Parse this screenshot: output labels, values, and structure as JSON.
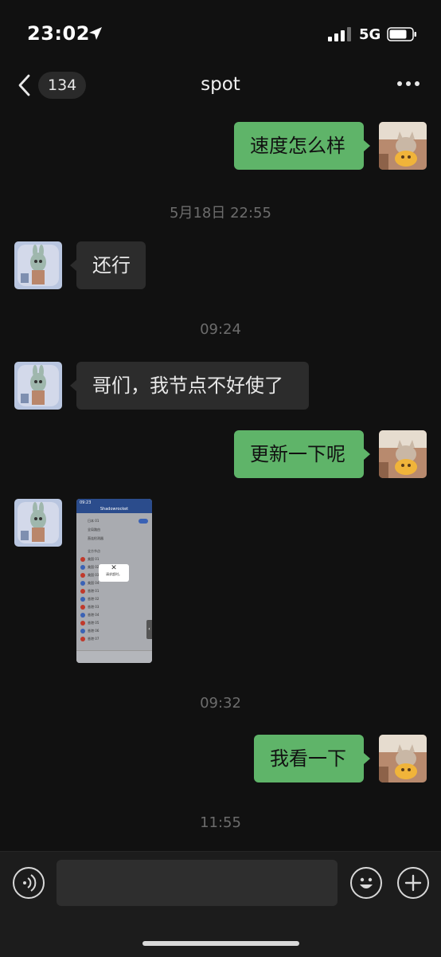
{
  "status": {
    "time": "23:02",
    "network": "5G"
  },
  "nav": {
    "badge_count": "134",
    "title": "spot"
  },
  "messages": [
    {
      "side": "out",
      "text": "速度怎么样"
    },
    {
      "side": "time",
      "text": "5月18日 22:55"
    },
    {
      "side": "in",
      "text": "还行"
    },
    {
      "side": "time",
      "text": "09:24"
    },
    {
      "side": "in",
      "text": "哥们，我节点不好使了"
    },
    {
      "side": "out",
      "text": "更新一下呢"
    },
    {
      "side": "in",
      "type": "image"
    },
    {
      "side": "time",
      "text": "09:32"
    },
    {
      "side": "out",
      "text": "我看一下"
    },
    {
      "side": "time",
      "text": "11:55"
    }
  ],
  "thumbnail": {
    "time": "09:23",
    "app_title": "Shadowrocket",
    "rows": [
      "日本 01",
      "全局路由",
      "直连检测器"
    ],
    "section": "全方节点",
    "nodes": [
      "美国 01",
      "美国 02",
      "美国 03",
      "美国 04",
      "香港 01",
      "香港 02",
      "香港 03",
      "香港 04",
      "香港 05",
      "香港 06",
      "香港 07"
    ],
    "popup_text": "请求超时。"
  },
  "colors": {
    "background": "#111111",
    "bubble_out": "#5fb469",
    "bubble_in": "#2c2c2c"
  },
  "icons": {
    "location": "location-arrow-icon",
    "signal": "signal-bars-icon",
    "battery": "battery-icon",
    "back": "chevron-left-icon",
    "more": "more-dots-icon",
    "voice": "voice-icon",
    "emoji": "emoji-icon",
    "add": "plus-icon"
  }
}
